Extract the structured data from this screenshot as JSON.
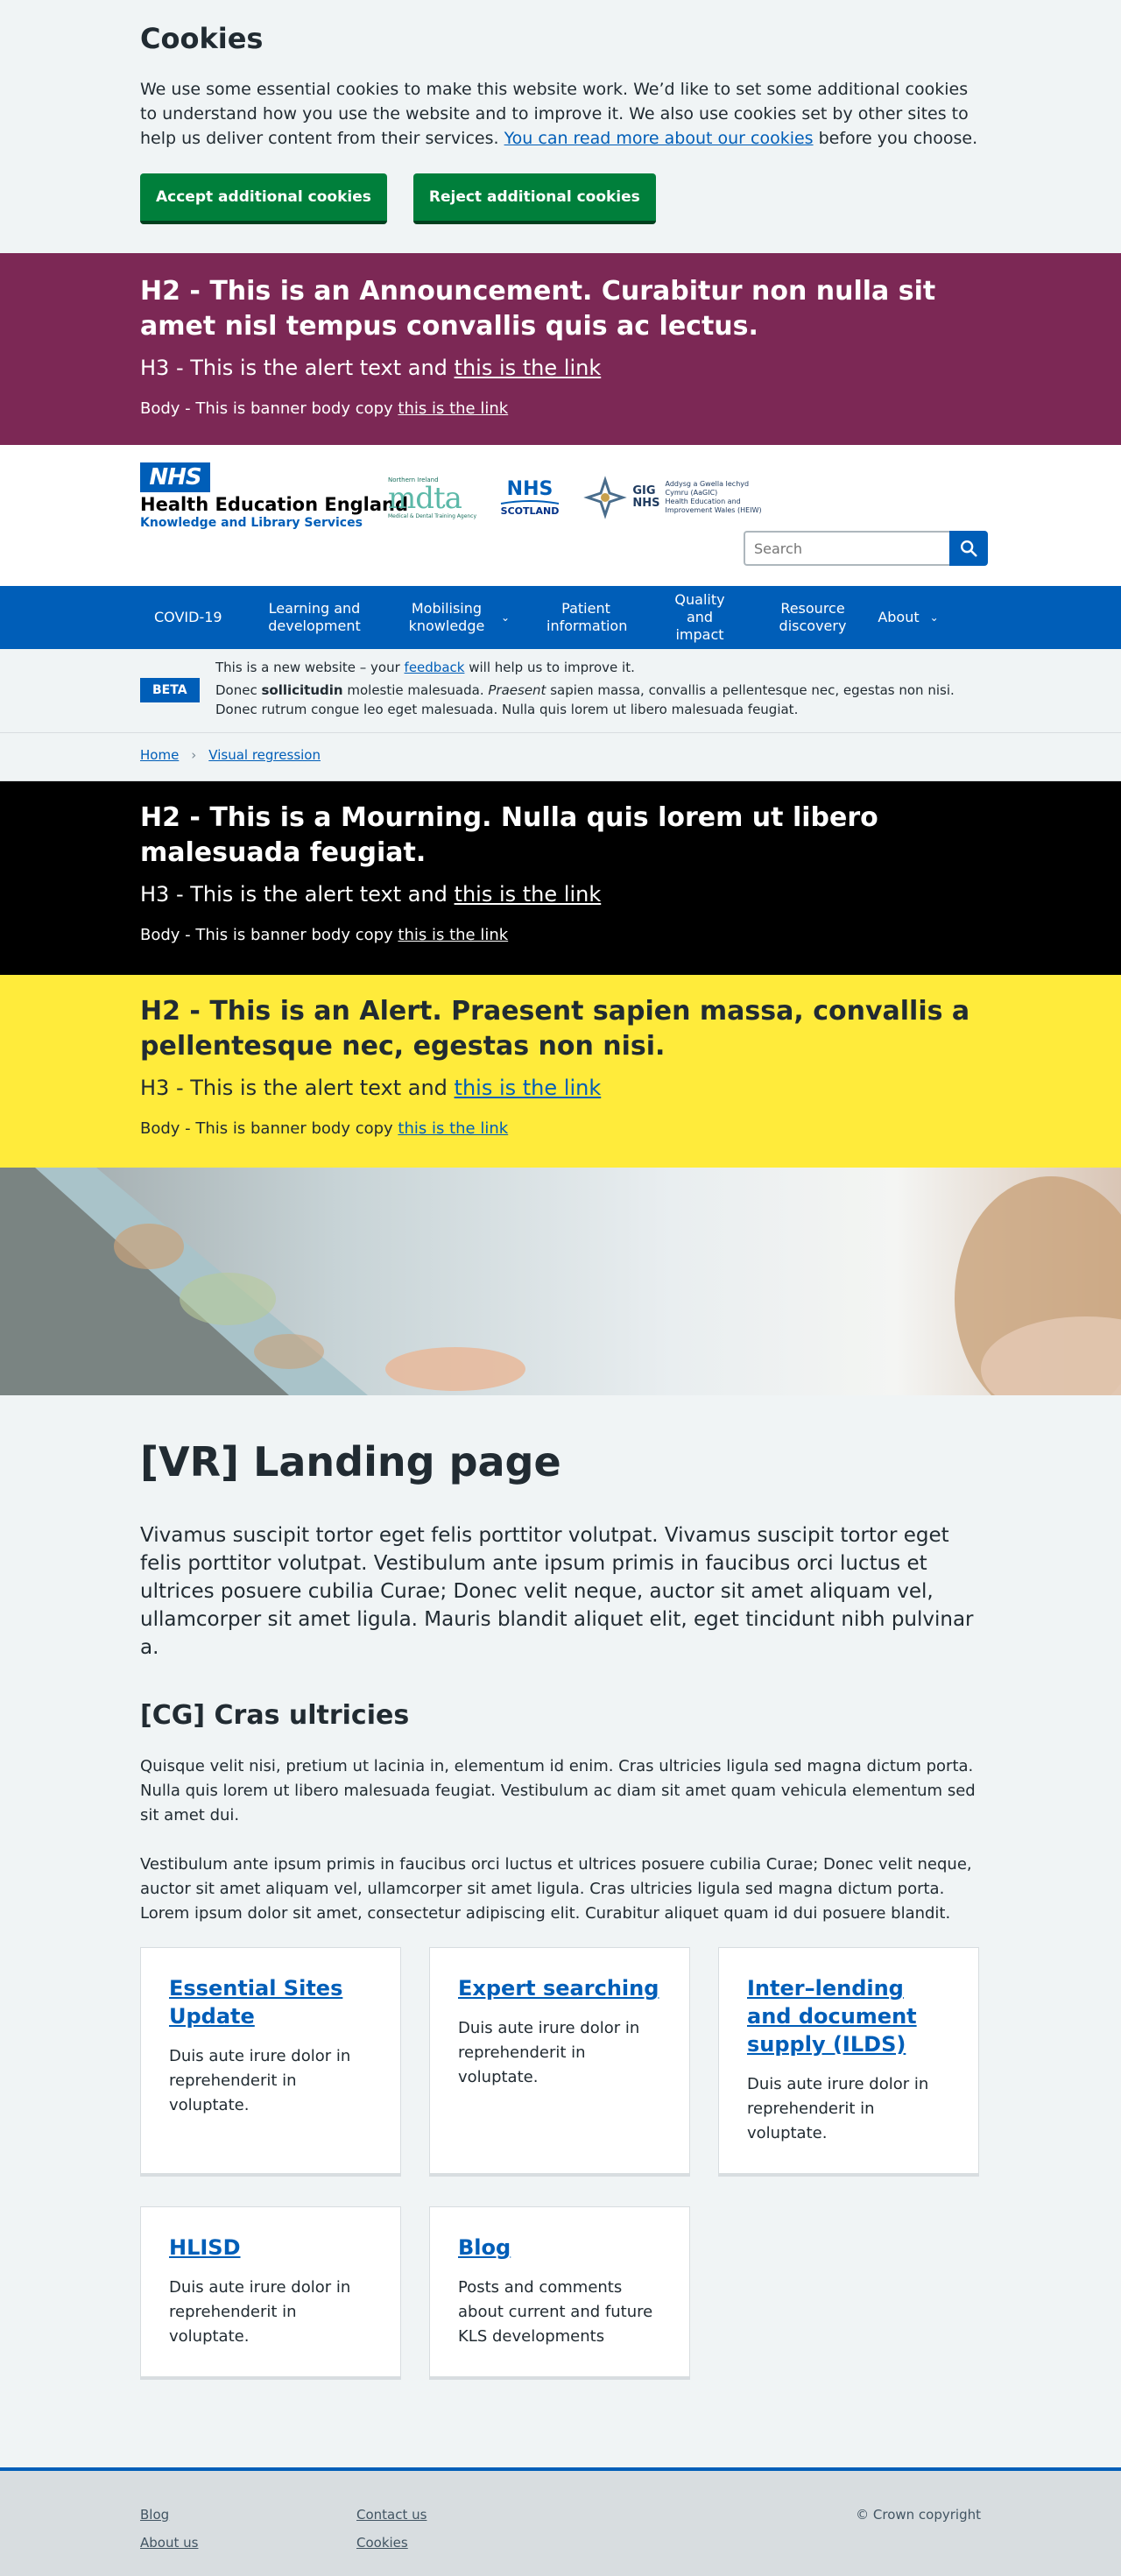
{
  "cookie": {
    "title": "Cookies",
    "text_before": "We use some essential cookies to make this website work. We’d like to set some additional cookies to understand how you use the website and to improve it. We also use cookies set by other sites to help us deliver content from their services. ",
    "link": "You can read more about our cookies",
    "text_after": " before you choose.",
    "accept_label": "Accept additional cookies",
    "reject_label": "Reject additional cookies"
  },
  "announcement": {
    "h2": "H2 - This is an Announcement. Curabitur non nulla sit amet nisl tempus convallis quis ac lectus.",
    "h3_text": "H3 - This is the alert text and ",
    "h3_link": "this is the link",
    "body_text": "Body - This is banner body copy ",
    "body_link": "this is the link"
  },
  "header": {
    "nhs_logo": "NHS",
    "org_name": "Health Education England",
    "org_sub": "Knowledge and Library Services",
    "partner_mdta_top": "Northern Ireland",
    "partner_mdta": "mdta",
    "partner_mdta_sub": "Medical & Dental Training Agency",
    "partner_scotland_nhs": "NHS",
    "partner_scotland": "SCOTLAND",
    "partner_wales_1": "Addysg a Gwella Iechyd",
    "partner_wales_2": "Cymru (AaGIC)",
    "partner_wales_3": "Health Education and",
    "partner_wales_4": "Improvement Wales (HEIW)",
    "partner_wales_gig": "GIG",
    "partner_wales_nhs": "NHS",
    "search_placeholder": "Search"
  },
  "nav": {
    "items": [
      {
        "label": "COVID-19"
      },
      {
        "label": "Learning and development"
      },
      {
        "label": "Mobilising knowledge"
      },
      {
        "label": "Patient information"
      },
      {
        "label": "Quality and impact"
      },
      {
        "label": "Resource discovery"
      },
      {
        "label": "About"
      }
    ]
  },
  "beta": {
    "tag": "BETA",
    "line1_before": "This is a new website – your ",
    "line1_link": "feedback",
    "line1_after": " will help us to improve it.",
    "line2_a": "Donec ",
    "line2_bold": "sollicitudin",
    "line2_b": " molestie malesuada. ",
    "line2_italic": "Praesent",
    "line2_c": " sapien massa, convallis a pellentesque nec, egestas non nisi. Donec rutrum congue leo eget malesuada. Nulla quis lorem ut libero malesuada feugiat."
  },
  "breadcrumb": {
    "home": "Home",
    "current": "Visual regression"
  },
  "mourning": {
    "h2": "H2 - This is a Mourning. Nulla quis lorem ut libero malesuada feugiat.",
    "h3_text": "H3 - This is the alert text and ",
    "h3_link": "this is the link",
    "body_text": "Body - This is banner body copy ",
    "body_link": "this is the link"
  },
  "alert": {
    "h2": "H2 - This is an Alert. Praesent sapien massa, convallis a pellentesque nec, egestas non nisi.",
    "h3_text": "H3 - This is the alert text and ",
    "h3_link": "this is the link",
    "body_text": "Body - This is banner body copy ",
    "body_link": "this is the link"
  },
  "main": {
    "title": "[VR] Landing page",
    "lede": "Vivamus suscipit tortor eget felis porttitor volutpat. Vivamus suscipit tortor eget felis porttitor volutpat. Vestibulum ante ipsum primis in faucibus orci luctus et ultrices posuere cubilia Curae; Donec velit neque, auctor sit amet aliquam vel, ullamcorper sit amet ligula. Mauris blandit aliquet elit, eget tincidunt nibh pulvinar a.",
    "section_title": "[CG] Cras ultricies",
    "para1": "Quisque velit nisi, pretium ut lacinia in, elementum id enim. Cras ultricies ligula sed magna dictum porta. Nulla quis lorem ut libero malesuada feugiat. Vestibulum ac diam sit amet quam vehicula elementum sed sit amet dui.",
    "para2": "Vestibulum ante ipsum primis in faucibus orci luctus et ultrices posuere cubilia Curae; Donec velit neque, auctor sit amet aliquam vel, ullamcorper sit amet ligula. Cras ultricies ligula sed magna dictum porta. Lorem ipsum dolor sit amet, consectetur adipiscing elit. Curabitur aliquet quam id dui posuere blandit.",
    "cards": [
      {
        "title": "Essential Sites Update",
        "text": "Duis aute irure dolor in reprehenderit in voluptate."
      },
      {
        "title": "Expert searching",
        "text": "Duis aute irure dolor in reprehenderit in voluptate."
      },
      {
        "title": "Inter–lending and document supply (ILDS)",
        "text": "Duis aute irure dolor in reprehenderit in voluptate."
      },
      {
        "title": "HLISD",
        "text": "Duis aute irure dolor in reprehenderit in voluptate."
      },
      {
        "title": "Blog",
        "text": "Posts and comments about current and future KLS developments"
      }
    ]
  },
  "footer": {
    "links_col1": [
      "Blog",
      "About us"
    ],
    "links_col2": [
      "Contact us",
      "Cookies"
    ],
    "copyright": "© Crown copyright"
  },
  "colors": {
    "nhs_blue": "#005eb8",
    "announcement": "#7c2855",
    "alert": "#ffeb3b",
    "button_green": "#007f3b"
  }
}
